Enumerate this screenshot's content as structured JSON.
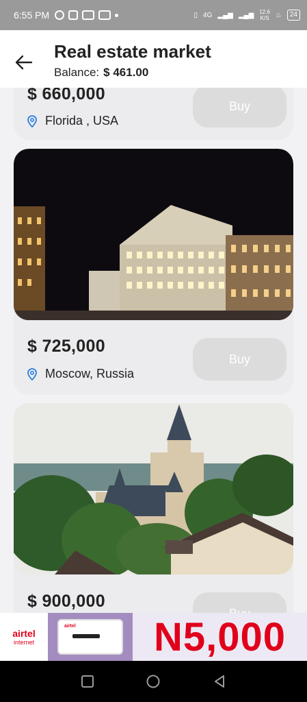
{
  "status_bar": {
    "time": "6:55 PM",
    "network": "4G",
    "speed_top": "12.6",
    "speed_bottom": "K/S",
    "battery": "24"
  },
  "header": {
    "title": "Real estate market",
    "balance_label": "Balance:",
    "balance_value": "$ 461.00"
  },
  "listings": [
    {
      "price": "$ 660,000",
      "location": "Florida , USA",
      "buy_label": "Buy"
    },
    {
      "price": "$ 725,000",
      "location": "Moscow, Russia",
      "buy_label": "Buy"
    },
    {
      "price": "$ 900,000",
      "location": "",
      "buy_label": "Buy"
    }
  ],
  "ad": {
    "brand": "airtel",
    "brand_sub": "internet",
    "device_label": "airtel",
    "price": "N5,000"
  },
  "colors": {
    "accent_red": "#e0001b",
    "pin_blue": "#2a7de1",
    "buy_disabled": "#dcdcdc"
  }
}
